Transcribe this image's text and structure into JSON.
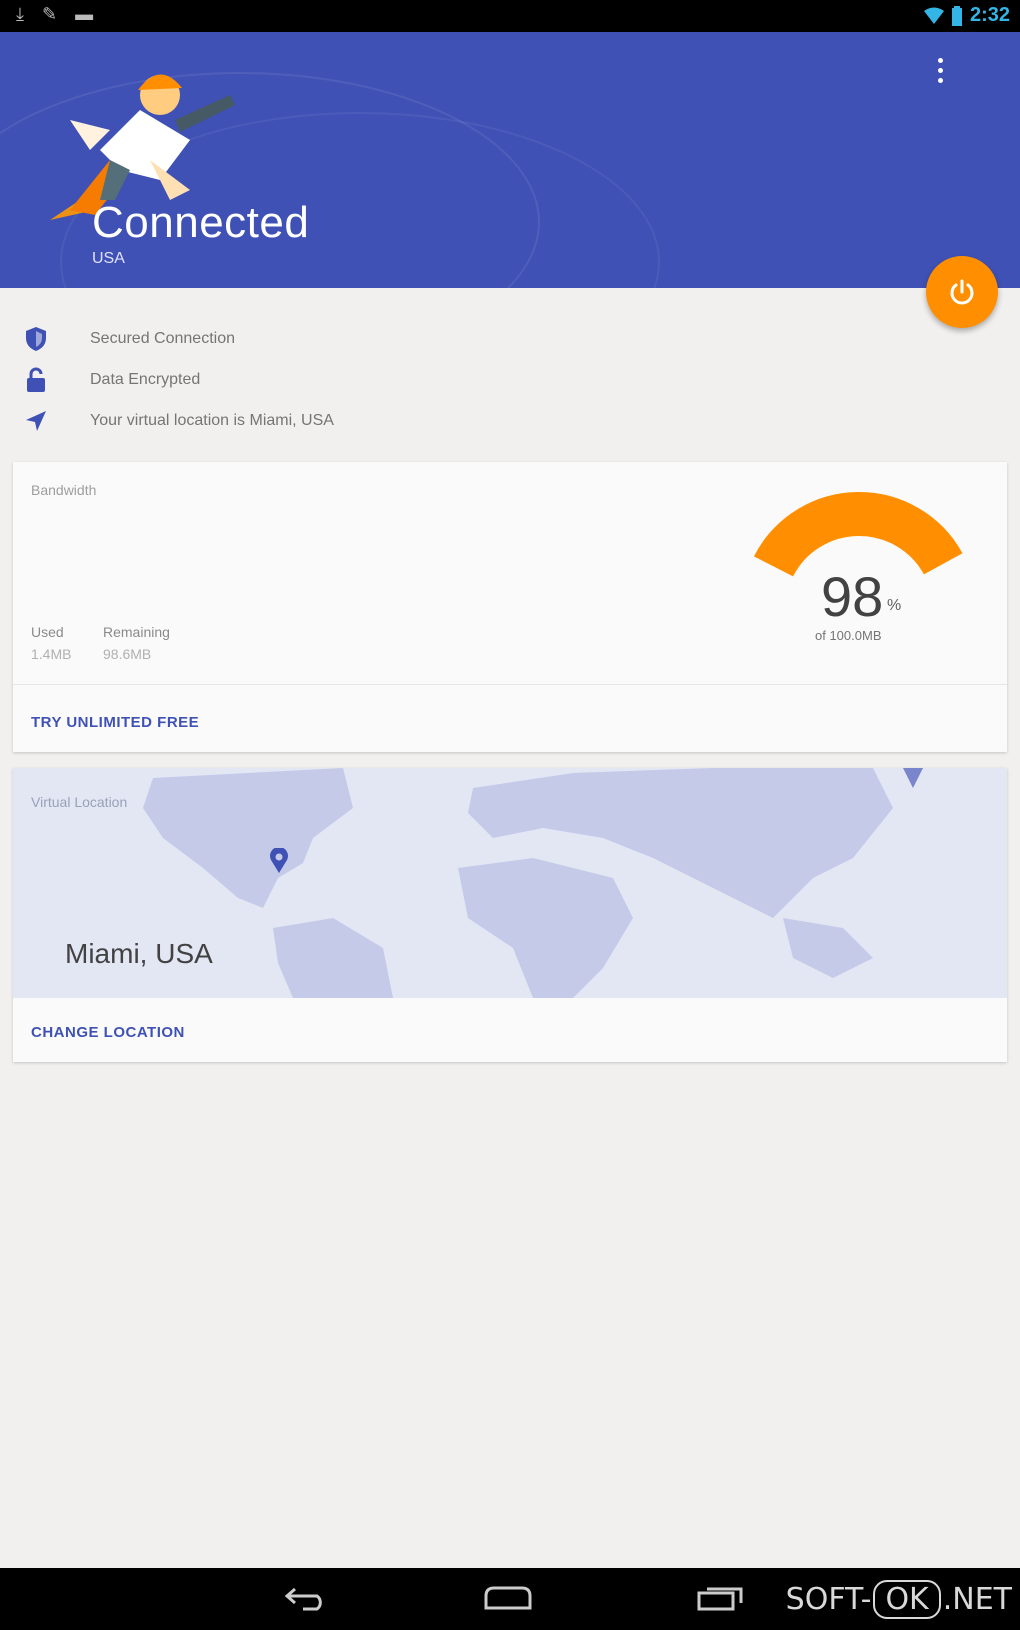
{
  "status_bar": {
    "time": "2:32",
    "left_icons": [
      "download-icon",
      "edit-icon",
      "game-icon"
    ],
    "right_icons": [
      "wifi-icon",
      "battery-icon"
    ]
  },
  "header": {
    "title": "Connected",
    "subtitle": "USA",
    "color": "#3f51b5",
    "menu_icon": "more-vert-icon"
  },
  "fab": {
    "icon": "power-icon",
    "color": "#ff8f00"
  },
  "status_items": [
    {
      "icon": "shield-icon",
      "text": "Secured Connection"
    },
    {
      "icon": "lock-icon",
      "text": "Data Encrypted"
    },
    {
      "icon": "navigation-icon",
      "text": "Your virtual location is Miami, USA"
    }
  ],
  "bandwidth": {
    "label": "Bandwidth",
    "used_label": "Used",
    "used_value": "1.4MB",
    "remaining_label": "Remaining",
    "remaining_value": "98.6MB",
    "percent": "98",
    "percent_unit": "%",
    "total": "of 100.0MB",
    "remaining_fraction": 0.986,
    "accent": "#ff8f00",
    "action": "TRY UNLIMITED FREE"
  },
  "location": {
    "label": "Virtual Location",
    "city": "Miami, USA",
    "action": "CHANGE LOCATION",
    "pin_icon": "map-pin-icon"
  },
  "nav": {
    "back_icon": "back-icon",
    "home_icon": "home-icon",
    "recents_icon": "recents-icon"
  },
  "watermark": {
    "pre": "SOFT-",
    "ok": "OK",
    "post": ".NET"
  }
}
